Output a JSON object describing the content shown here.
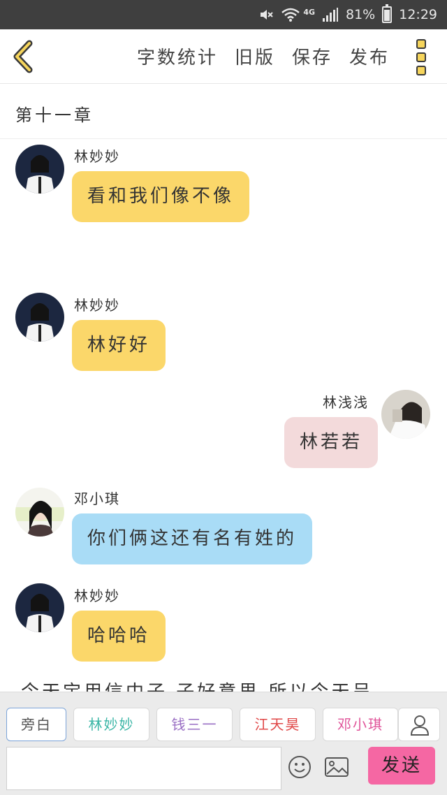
{
  "status_bar": {
    "network": "4G",
    "battery": "81%",
    "time": "12:29"
  },
  "header": {
    "back_icon": "chevron-left-icon",
    "actions": [
      "字数统计",
      "旧版",
      "保存",
      "发布"
    ],
    "more_icon": "vertical-dots-icon"
  },
  "chapter": {
    "title": "第十一章"
  },
  "messages": [
    {
      "name": "林妙妙",
      "text": "看和我们像不像",
      "side": "left",
      "color": "#fbd76a"
    },
    {
      "name": "林妙妙",
      "text": "林好好",
      "side": "left",
      "color": "#fbd76a"
    },
    {
      "name": "林浅浅",
      "text": "林若若",
      "side": "right",
      "color": "#f3dadb"
    },
    {
      "name": "邓小琪",
      "text": "你们俩这还有名有姓的",
      "side": "left",
      "color": "#a9dcf6"
    },
    {
      "name": "林妙妙",
      "text": "哈哈哈",
      "side": "left",
      "color": "#fbd76a"
    }
  ],
  "partial_text": "今天宝用信中子 子好意思 所以今天呈",
  "roles": [
    {
      "label": "旁白",
      "color": "#555555"
    },
    {
      "label": "林妙妙",
      "color": "#3bb6a6"
    },
    {
      "label": "钱三一",
      "color": "#9a6fc4"
    },
    {
      "label": "江天昊",
      "color": "#e04848"
    },
    {
      "label": "邓小琪",
      "color": "#e0559a"
    }
  ],
  "composer": {
    "input_value": "",
    "input_placeholder": "",
    "send_label": "发送",
    "emoji_icon": "smiley-icon",
    "image_icon": "image-icon",
    "person_icon": "person-icon"
  }
}
